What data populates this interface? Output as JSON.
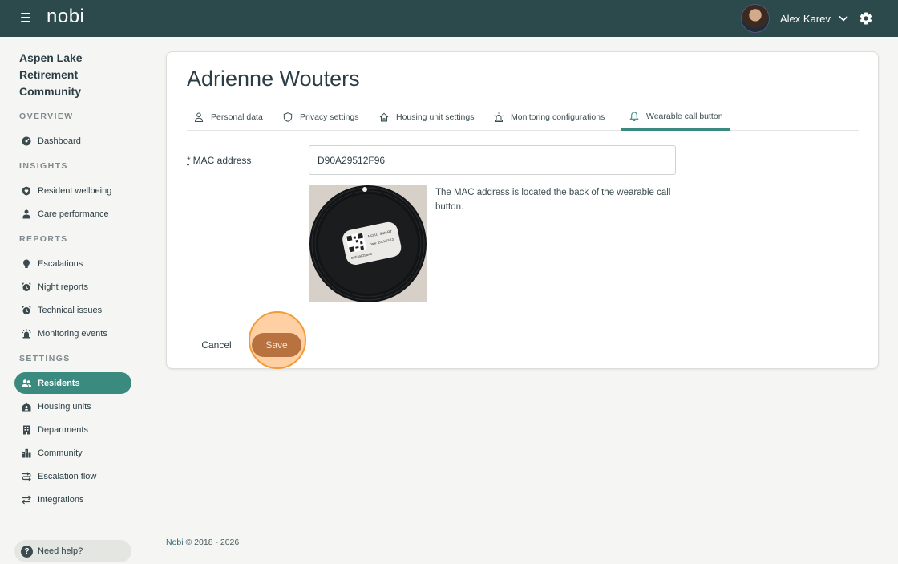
{
  "topbar": {
    "brand": "nobi",
    "user_name": "Alex Karev"
  },
  "sidebar": {
    "community_lines": [
      "Aspen Lake",
      "Retirement",
      "Community"
    ],
    "sections": {
      "overview": "OVERVIEW",
      "insights": "INSIGHTS",
      "reports": "REPORTS",
      "settings": "SETTINGS"
    },
    "items": {
      "dashboard": "Dashboard",
      "resident_wellbeing": "Resident wellbeing",
      "care_performance": "Care performance",
      "escalations": "Escalations",
      "night_reports": "Night reports",
      "technical_issues": "Technical issues",
      "monitoring_events": "Monitoring events",
      "residents": "Residents",
      "housing_units": "Housing units",
      "departments": "Departments",
      "community": "Community",
      "escalation_flow": "Escalation flow",
      "integrations": "Integrations"
    },
    "help": "Need help?"
  },
  "main": {
    "title": "Adrienne Wouters",
    "tabs": {
      "personal": "Personal data",
      "privacy": "Privacy settings",
      "housing": "Housing unit settings",
      "monitoring": "Monitoring configurations",
      "wearable": "Wearable call button"
    },
    "form": {
      "required_mark": "*",
      "mac_label": "MAC address",
      "mac_value": "D90A29512F96",
      "hint": "The MAC address is located the back of the wearable call button.",
      "cancel": "Cancel",
      "save": "Save"
    },
    "photo_text": {
      "brand": "MOKO SMART",
      "date": "Date: 2021/03/13",
      "serial": "D7E34029BA3"
    }
  },
  "footer": {
    "brand": "Nobi",
    "copyright": "© 2018 - 2026"
  },
  "colors": {
    "topbar": "#2c4a4b",
    "accent": "#3b8a80",
    "save_button": "#b7723f",
    "highlight_ring": "#f39b36"
  }
}
